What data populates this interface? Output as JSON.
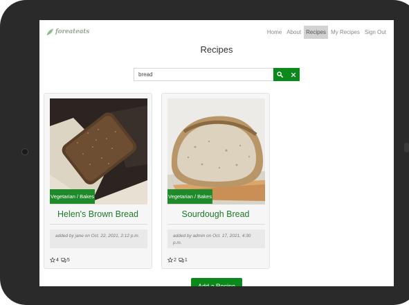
{
  "nav": {
    "logo_text": "foreateats",
    "links": [
      "Home",
      "About",
      "Recipes",
      "My Recipes",
      "Sign Out"
    ],
    "active": "Recipes"
  },
  "page": {
    "title": "Recipes"
  },
  "search": {
    "value": "bread",
    "search_icon": "search-icon",
    "clear_icon": "close-icon"
  },
  "recipes": [
    {
      "title": "Helen's Brown Bread",
      "category": "Vegetarian / Bakes",
      "meta": "added by jane on Oct. 22, 2021, 2:12 p.m.",
      "likes": "4",
      "comments": "5"
    },
    {
      "title": "Sourdough Bread",
      "category": "Vegetarian / Bakes",
      "meta": "added by admin on Oct. 17, 2021, 4:30 p.m.",
      "likes": "2",
      "comments": "1"
    }
  ],
  "add_button": "Add a Recipe",
  "colors": {
    "accent": "#0b8a1b",
    "title_green": "#1d7a28",
    "badge": "#1f8a2a",
    "frame": "#2a2a2a"
  }
}
